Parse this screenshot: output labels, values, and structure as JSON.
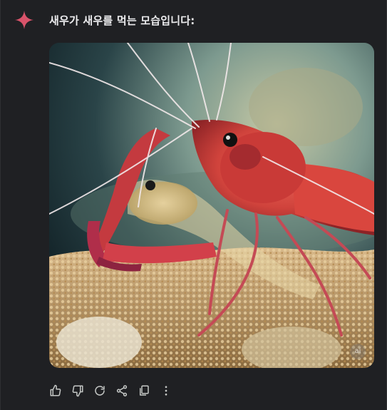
{
  "message": {
    "title": "새우가 새우를 먹는 모습입니다:",
    "image_alt": "shrimp-eating-shrimp-image",
    "ai_badge": "ai"
  },
  "colors": {
    "background": "#1f2023",
    "accent_star": "#d9536a",
    "text": "#ececee",
    "icon": "#c4c7c5"
  },
  "actions": [
    {
      "icon": "thumbs-up-icon"
    },
    {
      "icon": "thumbs-down-icon"
    },
    {
      "icon": "regenerate-icon"
    },
    {
      "icon": "share-icon"
    },
    {
      "icon": "copy-icon"
    },
    {
      "icon": "more-options-icon"
    }
  ]
}
